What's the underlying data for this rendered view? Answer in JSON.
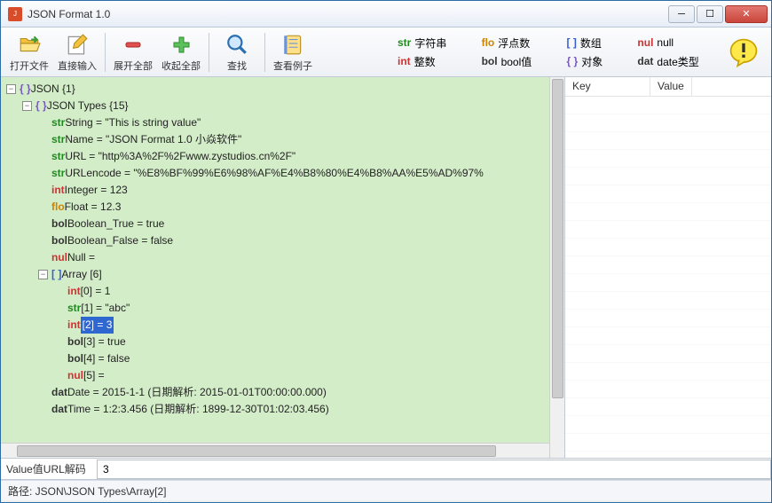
{
  "window": {
    "title": "JSON Format 1.0"
  },
  "toolbar": {
    "open_file": "打开文件",
    "direct_input": "直接输入",
    "expand_all": "展开全部",
    "collapse_all": "收起全部",
    "find": "查找",
    "view_example": "查看例子"
  },
  "legend": {
    "str": {
      "tag": "str",
      "label": "字符串"
    },
    "flo": {
      "tag": "flo",
      "label": "浮点数"
    },
    "arr": {
      "tag": "[ ]",
      "label": "数组"
    },
    "nul": {
      "tag": "nul",
      "label": "null"
    },
    "int": {
      "tag": "int",
      "label": "整数"
    },
    "bol": {
      "tag": "bol",
      "label": "bool值"
    },
    "obj": {
      "tag": "{ }",
      "label": "对象"
    },
    "dat": {
      "tag": "dat",
      "label": "date类型"
    }
  },
  "tree": {
    "root": {
      "tag": "{ }",
      "text": "JSON {1}"
    },
    "types": {
      "tag": "{ }",
      "text": "JSON Types {15}"
    },
    "items": [
      {
        "cls": "c-str",
        "tag": "str",
        "text": "String = \"This is string value\""
      },
      {
        "cls": "c-str",
        "tag": "str",
        "text": "Name = \"JSON Format 1.0 小焱软件\""
      },
      {
        "cls": "c-str",
        "tag": "str",
        "text": "URL = \"http%3A%2F%2Fwww.zystudios.cn%2F\""
      },
      {
        "cls": "c-str",
        "tag": "str",
        "text": "URLencode = \"%E8%BF%99%E6%98%AF%E4%B8%80%E4%B8%AA%E5%AD%97%"
      },
      {
        "cls": "c-int",
        "tag": "int",
        "text": "Integer = 123"
      },
      {
        "cls": "c-flo",
        "tag": "flo",
        "text": "Float = 12.3"
      },
      {
        "cls": "c-bol",
        "tag": "bol",
        "text": "Boolean_True = true"
      },
      {
        "cls": "c-bol",
        "tag": "bol",
        "text": "Boolean_False = false"
      },
      {
        "cls": "c-nul",
        "tag": "nul",
        "text": "Null ="
      }
    ],
    "array_node": {
      "tag": "[ ]",
      "text": "Array [6]"
    },
    "array_items": [
      {
        "cls": "c-int",
        "tag": "int",
        "text": "[0] = 1",
        "sel": false
      },
      {
        "cls": "c-str",
        "tag": "str",
        "text": "[1] = \"abc\"",
        "sel": false
      },
      {
        "cls": "c-int",
        "tag": "int",
        "text": "[2] = 3",
        "sel": true
      },
      {
        "cls": "c-bol",
        "tag": "bol",
        "text": "[3] = true",
        "sel": false
      },
      {
        "cls": "c-bol",
        "tag": "bol",
        "text": "[4] = false",
        "sel": false
      },
      {
        "cls": "c-nul",
        "tag": "nul",
        "text": "[5] =",
        "sel": false
      }
    ],
    "after": [
      {
        "cls": "c-dat",
        "tag": "dat",
        "text": "Date = 2015-1-1 (日期解析: 2015-01-01T00:00:00.000)"
      },
      {
        "cls": "c-dat",
        "tag": "dat",
        "text": "Time = 1:2:3.456 (日期解析: 1899-12-30T01:02:03.456)"
      }
    ]
  },
  "kv": {
    "key_header": "Key",
    "value_header": "Value"
  },
  "valuebar": {
    "label": "Value值URL解码",
    "value": "3"
  },
  "statusbar": {
    "text": "路径: JSON\\JSON Types\\Array[2]"
  }
}
